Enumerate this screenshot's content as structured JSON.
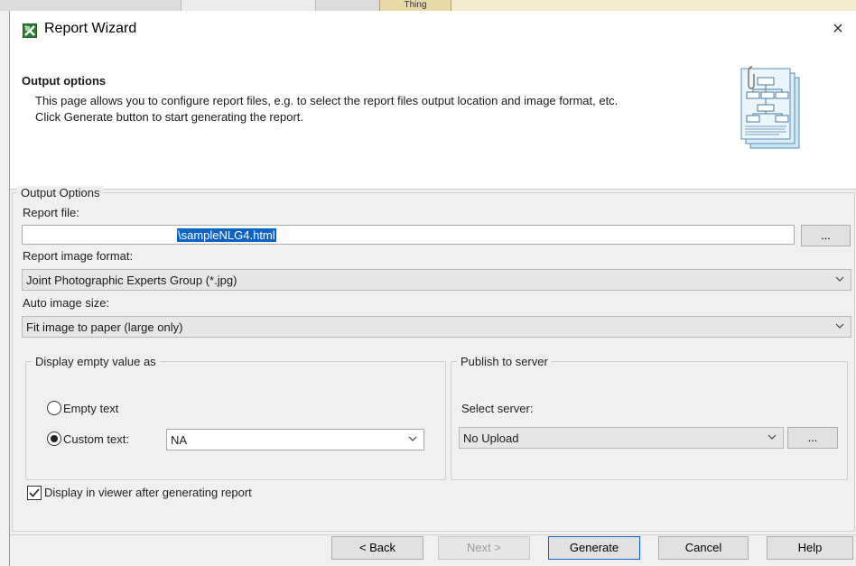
{
  "background": {
    "tab_label": "Thing"
  },
  "dialog": {
    "title": "Report Wizard",
    "close_glyph": "×"
  },
  "header": {
    "title": "Output options",
    "desc_line1": "This page allows you to configure report files, e.g. to select the report files output location and image format, etc.",
    "desc_line2": "Click Generate button to start generating the report."
  },
  "output_options": {
    "group_label": "Output Options",
    "report_file_label": "Report file:",
    "report_file_value": "\\sampleNLG4.html",
    "browse_label": "...",
    "image_format_label": "Report image format:",
    "image_format_value": "Joint Photographic Experts Group (*.jpg)",
    "auto_size_label": "Auto image size:",
    "auto_size_value": "Fit image to paper (large only)"
  },
  "empty_value": {
    "group_label": "Display empty value as",
    "empty_text_label": "Empty text",
    "empty_text_selected": false,
    "custom_text_label": "Custom text:",
    "custom_text_selected": true,
    "custom_text_value": "NA"
  },
  "publish": {
    "group_label": "Publish to server",
    "select_server_label": "Select server:",
    "server_value": "No Upload",
    "browse_label": "..."
  },
  "viewer": {
    "label": "Display in viewer after generating report",
    "checked": true
  },
  "footer": {
    "back_label": "< Back",
    "next_label": "Next >",
    "generate_label": "Generate",
    "cancel_label": "Cancel",
    "help_label": "Help"
  },
  "colors": {
    "accent": "#0a64c8",
    "dialog_bg": "#f0f0f0",
    "header_bg": "#ffffff"
  }
}
